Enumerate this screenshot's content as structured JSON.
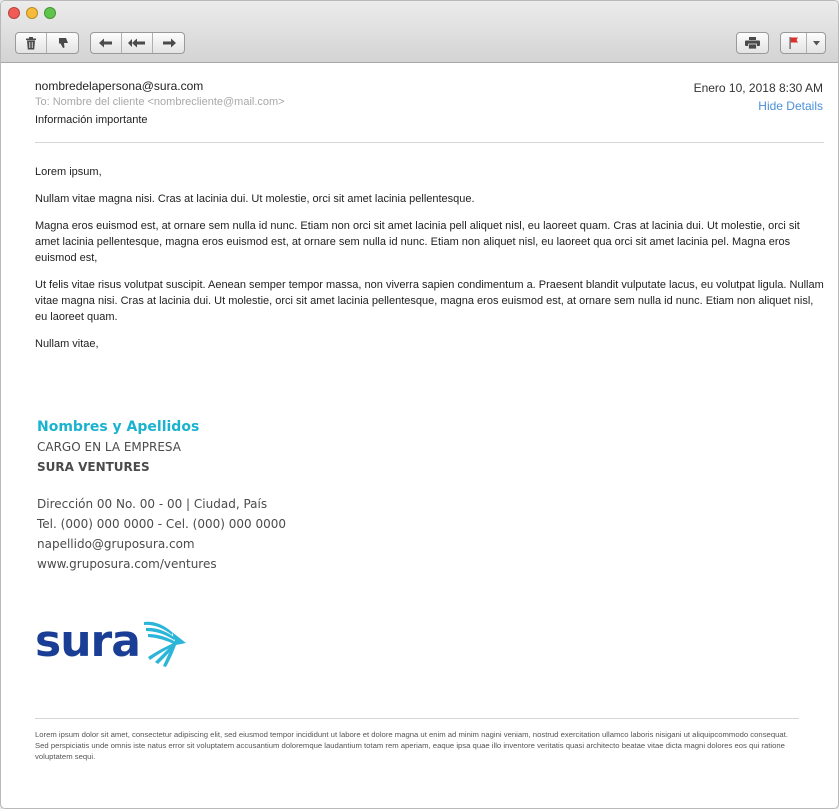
{
  "window": {
    "toolbar": {
      "delete_icon": "trash-icon",
      "junk_icon": "thumbs-down-icon",
      "reply_icon": "reply-arrow-icon",
      "reply_all_icon": "reply-all-arrow-icon",
      "forward_icon": "forward-arrow-icon",
      "print_icon": "printer-icon",
      "flag_icon": "flag-icon",
      "flag_color": "#d9322b"
    }
  },
  "header": {
    "from": "nombredelapersona@sura.com",
    "to": "To: Nombre del cliente <nombrecliente@mail.com>",
    "subject": "Información importante",
    "date": "Enero 10, 2018 8:30 AM",
    "hide_details": "Hide Details"
  },
  "body": {
    "greeting": "Lorem ipsum,",
    "p1": "Nullam vitae magna nisi. Cras at lacinia dui. Ut molestie, orci sit amet lacinia pellentesque.",
    "p2": "Magna eros euismod est, at ornare sem nulla id nunc. Etiam non orci sit amet lacinia pell aliquet nisl, eu laoreet quam. Cras at lacinia dui. Ut molestie, orci sit amet lacinia pellentesque, magna eros euismod est, at ornare sem nulla id nunc. Etiam non aliquet nisl, eu laoreet qua orci sit amet lacinia pel. Magna eros euismod est,",
    "p3": "Ut felis vitae risus volutpat suscipit. Aenean semper tempor massa, non viverra sapien condimentum a. Praesent blandit vulputate lacus, eu volutpat ligula. Nullam vitae magna nisi. Cras at lacinia dui. Ut molestie, orci sit amet lacinia pellentesque, magna eros euismod est, at ornare sem nulla id nunc. Etiam non aliquet nisl, eu laoreet quam.",
    "closing": "Nullam vitae,"
  },
  "signature": {
    "name": "Nombres y Apellidos",
    "title": "CARGO EN LA EMPRESA",
    "company": "SURA VENTURES",
    "address": "Dirección 00 No. 00 - 00 | Ciudad, País",
    "phones": "Tel. (000) 000 0000 - Cel. (000) 000 0000",
    "email": "napellido@gruposura.com",
    "website": "www.gruposura.com/ventures",
    "name_color": "#1ab3cf"
  },
  "logo": {
    "text": "sura",
    "text_color": "#1a3e96",
    "wing_color": "#2bb5d9"
  },
  "footer": {
    "text": "Lorem ipsum dolor sit amet, consectetur adipiscing elit, sed eiusmod tempor incididunt ut labore et dolore magna ut enim ad minim nagini veniam,  nostrud exercitation ullamco laboris nisigani ut aliquipcommodo consequat. Sed perspiciatis unde omnis iste natus error sit voluptatem accusantium doloremque laudantium totam rem aperiam, eaque ipsa quae illo inventore veritatis quasi architecto beatae vitae dicta magni dolores eos qui ratione voluptatem sequi."
  }
}
